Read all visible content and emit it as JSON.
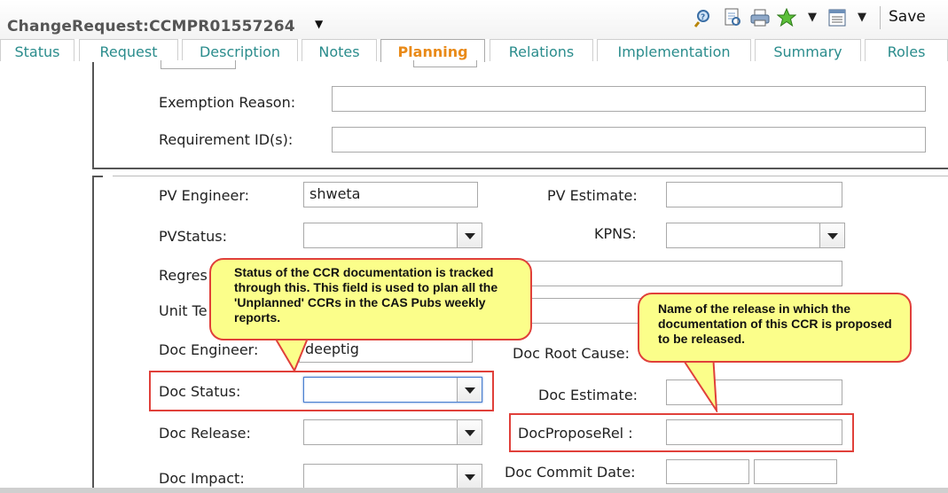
{
  "header": {
    "title": "ChangeRequest:CCMPR01557264",
    "save_label": "Save"
  },
  "icons": [
    "search-icon",
    "report-icon",
    "print-icon",
    "favorite-star-icon",
    "dropdown-caret-icon",
    "list-view-icon",
    "dropdown-caret-icon"
  ],
  "tabs": [
    {
      "label": "Status"
    },
    {
      "label": "Request"
    },
    {
      "label": "Description"
    },
    {
      "label": "Notes"
    },
    {
      "label": "Planning",
      "active": true
    },
    {
      "label": "Relations"
    },
    {
      "label": "Implementation"
    },
    {
      "label": "Summary"
    },
    {
      "label": "Roles"
    }
  ],
  "top_section": {
    "exemption_reason_label": "Exemption Reason:",
    "exemption_reason_value": "",
    "requirement_ids_label": "Requirement ID(s):",
    "requirement_ids_value": ""
  },
  "planning": {
    "pv_engineer_label": "PV Engineer:",
    "pv_engineer_value": "shweta",
    "pv_estimate_label": "PV Estimate:",
    "pv_estimate_value": "",
    "pv_status_label": "PVStatus:",
    "pv_status_value": "",
    "kpns_label": "KPNS:",
    "kpns_value": "",
    "regression_label_partial": "Regres",
    "unit_test_label_partial": "Unit Te",
    "doc_engineer_label": "Doc Engineer:",
    "doc_engineer_value": "deeptig",
    "doc_root_cause_label": "Doc Root Cause:",
    "doc_status_label": "Doc Status:",
    "doc_status_value": "",
    "doc_estimate_label": "Doc Estimate:",
    "doc_estimate_value": "",
    "doc_release_label": "Doc Release:",
    "doc_release_value": "",
    "doc_propose_rel_label": "DocProposeRel :",
    "doc_propose_rel_value": "",
    "doc_impact_label": "Doc Impact:",
    "doc_impact_value": "",
    "doc_commit_date_label": "Doc Commit Date:",
    "doc_commit_date_value": ""
  },
  "callouts": {
    "doc_status_note": "Status of the CCR documentation is tracked through this. This field is used to plan all the 'Unplanned' CCRs in the CAS Pubs weekly reports.",
    "doc_propose_rel_note": "Name of the release in which the documentation of this CCR is proposed to be released."
  },
  "colors": {
    "tab_text": "#2a8c8c",
    "tab_active": "#e98a18",
    "callout_fill": "#fbfe8a",
    "highlight_red": "#e0403a"
  }
}
